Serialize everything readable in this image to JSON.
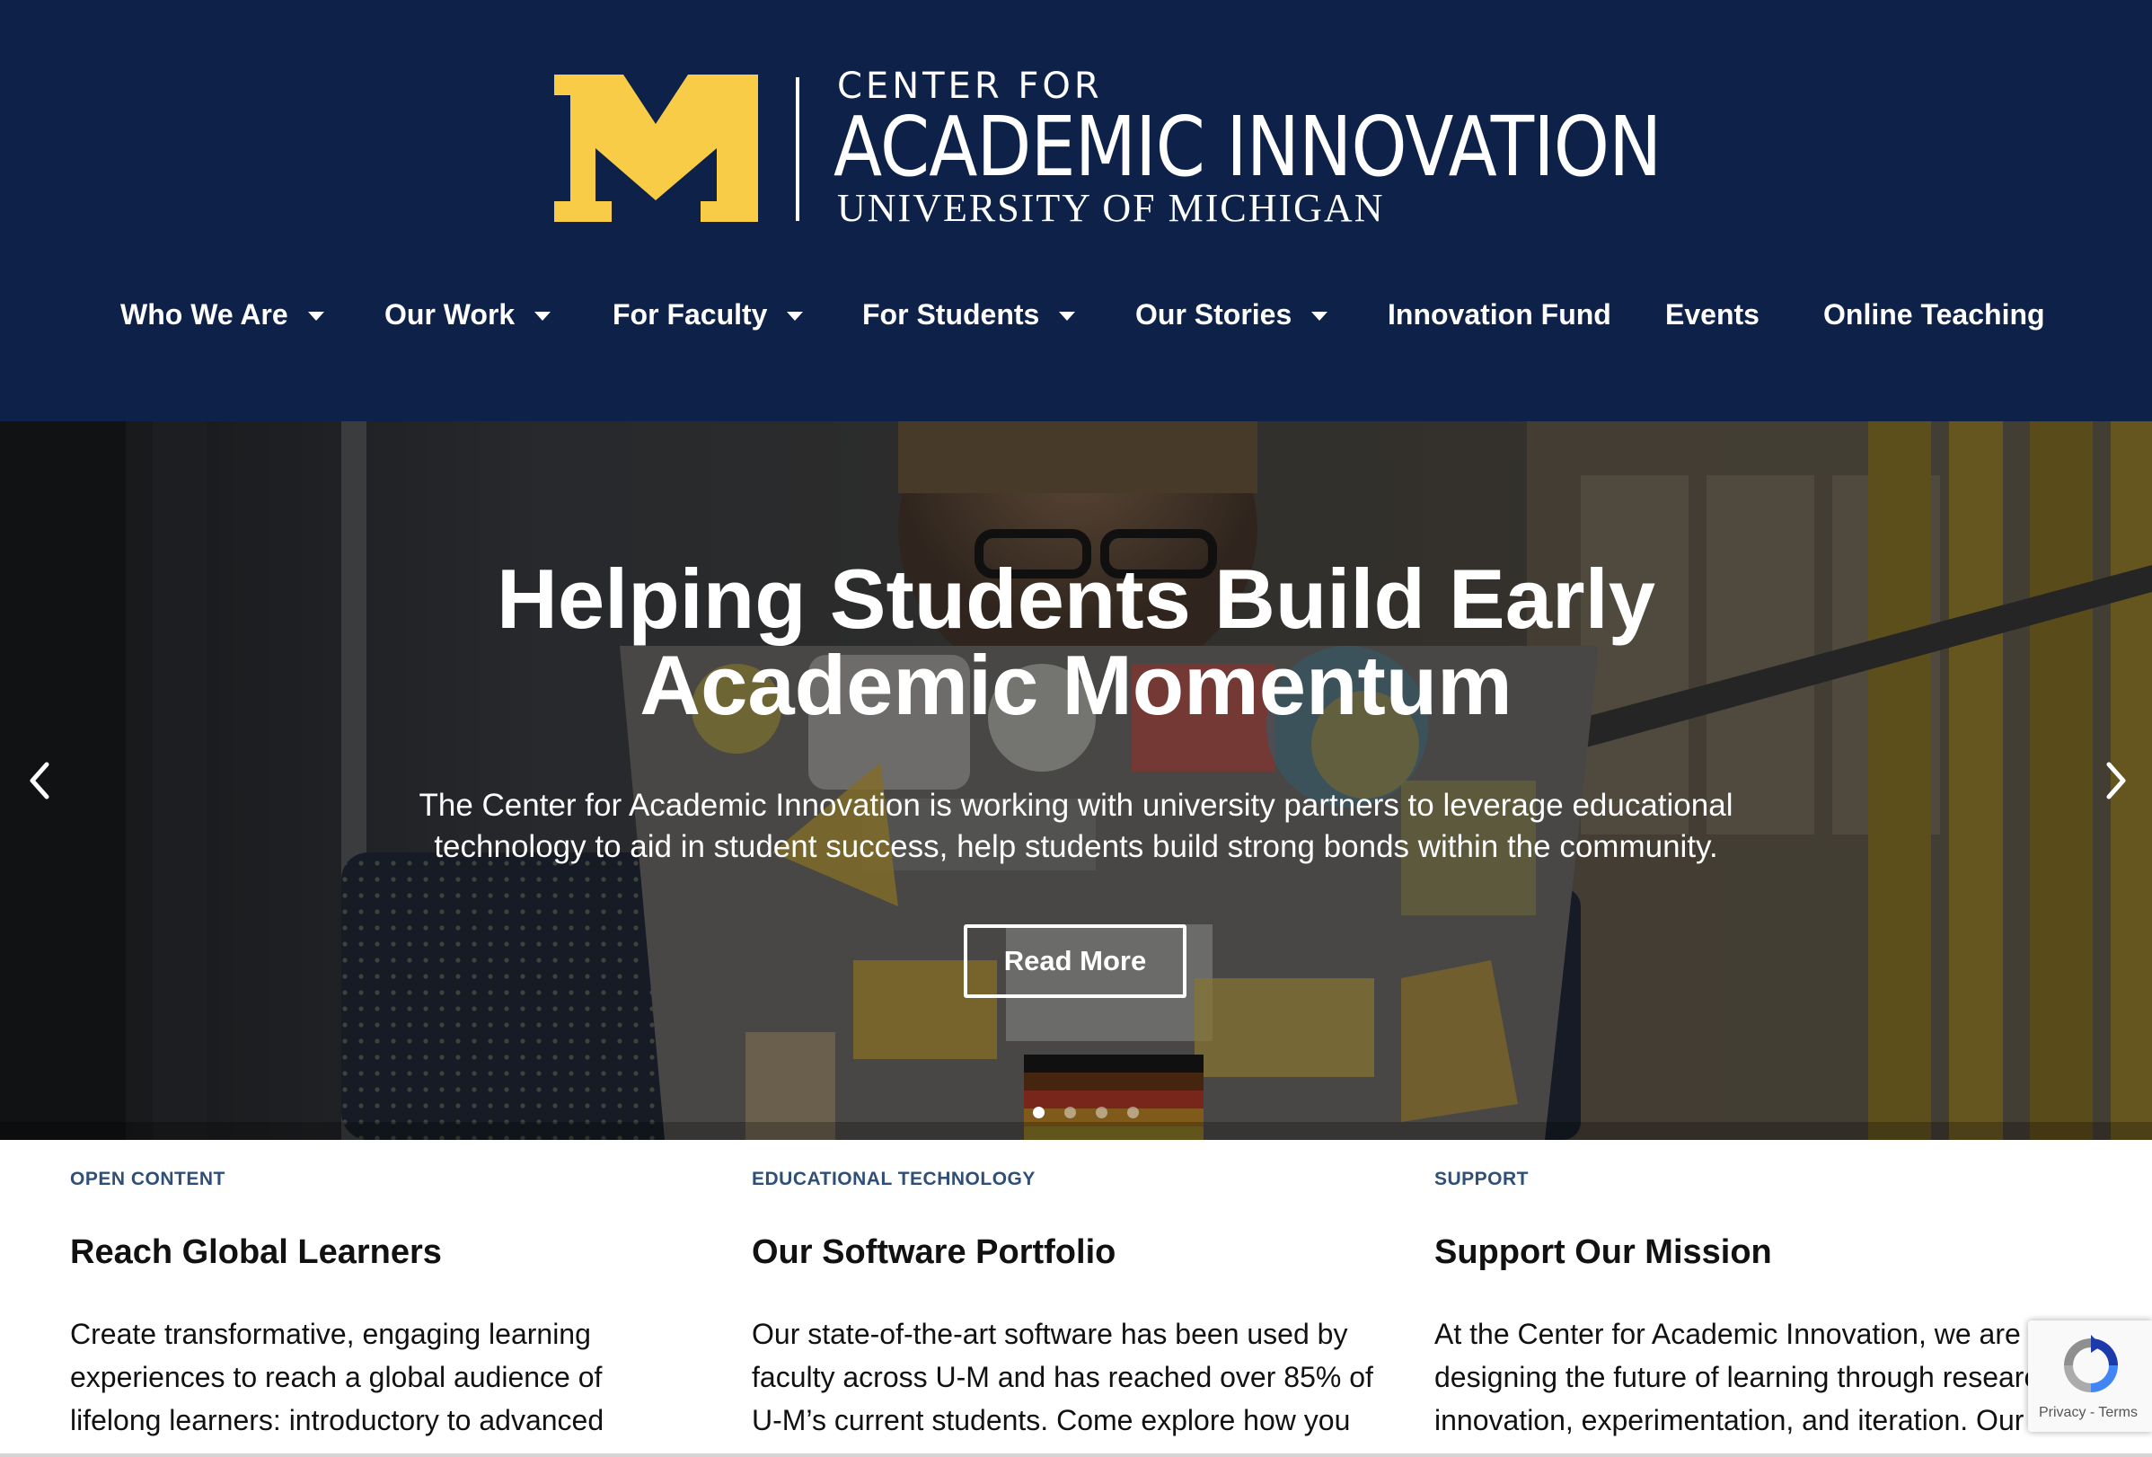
{
  "header": {
    "logo_line1": "CENTER FOR",
    "logo_line2": "ACADEMIC INNOVATION",
    "logo_line3": "UNIVERSITY OF MICHIGAN",
    "logo_mark_text": "M",
    "colors": {
      "background": "#0e2249",
      "maize": "#f8cc46",
      "text": "#ffffff"
    }
  },
  "nav": {
    "items": [
      {
        "label": "Who We Are",
        "has_dropdown": true
      },
      {
        "label": "Our Work",
        "has_dropdown": true
      },
      {
        "label": "For Faculty",
        "has_dropdown": true
      },
      {
        "label": "For Students",
        "has_dropdown": true
      },
      {
        "label": "Our Stories",
        "has_dropdown": true
      },
      {
        "label": "Innovation Fund",
        "has_dropdown": false
      },
      {
        "label": "Events",
        "has_dropdown": false
      },
      {
        "label": "Online Teaching",
        "has_dropdown": false
      }
    ]
  },
  "hero": {
    "title_line1": "Helping Students Build Early",
    "title_line2": "Academic Momentum",
    "text_line1": "The Center for Academic Innovation is working with university partners to leverage educational",
    "text_line2": "technology to aid in student success, help students build strong bonds within the community.",
    "button_label": "Read More",
    "slide_count": 4,
    "active_slide": 1,
    "prev_icon": "chevron-left-icon",
    "next_icon": "chevron-right-icon"
  },
  "features": [
    {
      "eyebrow": "OPEN CONTENT",
      "title": "Reach Global Learners",
      "lines": [
        "Create transformative, engaging learning",
        "experiences to reach a global audience of",
        "lifelong learners: introductory to advanced"
      ]
    },
    {
      "eyebrow": "EDUCATIONAL TECHNOLOGY",
      "title": "Our Software Portfolio",
      "lines": [
        "Our state-of-the-art software has been used by",
        "faculty across U-M and has reached over 85% of",
        "U-M’s current students. Come explore how you"
      ]
    },
    {
      "eyebrow": "SUPPORT",
      "title": "Support Our Mission",
      "lines": [
        "At the Center for Academic Innovation, we are",
        "designing the future of learning through research,",
        "innovation, experimentation, and iteration. Our"
      ]
    }
  ],
  "recaptcha": {
    "privacy_label": "Privacy",
    "separator": " - ",
    "terms_label": "Terms",
    "icon": "recaptcha-icon"
  }
}
